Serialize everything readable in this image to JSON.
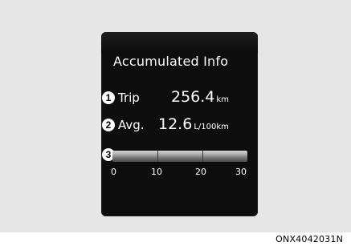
{
  "display": {
    "title": "Accumulated Info",
    "items": [
      {
        "number": "1",
        "label": "Trip",
        "value": "256.4",
        "unit": "km"
      },
      {
        "number": "2",
        "label": "Avg.",
        "value": "12.6",
        "unit": "L/100km"
      },
      {
        "number": "3"
      }
    ],
    "gauge": {
      "ticks": [
        "0",
        "10",
        "20",
        "30"
      ],
      "min": 0,
      "max": 30
    }
  },
  "caption": "ONX4042031N"
}
